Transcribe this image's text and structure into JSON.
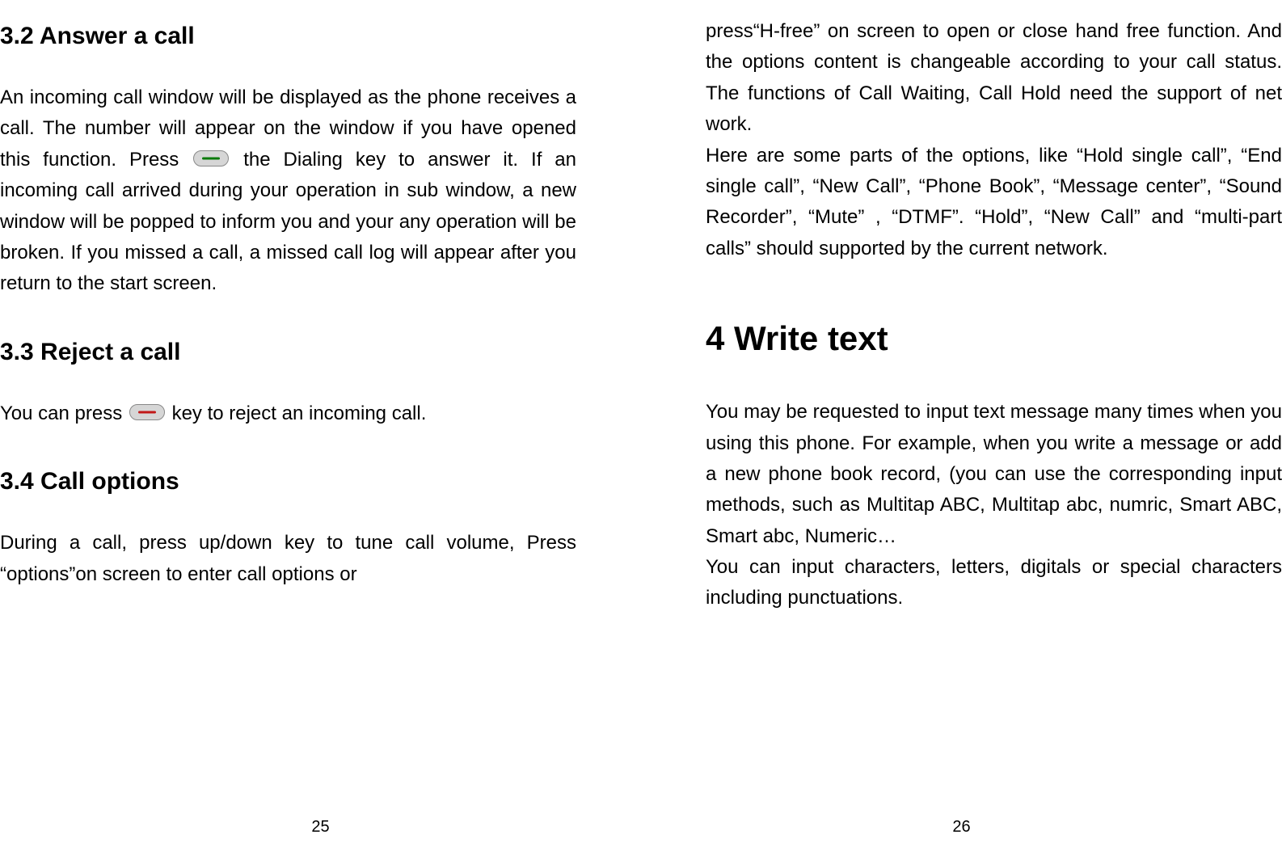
{
  "left": {
    "sec32_title": "3.2  Answer a call",
    "sec32_body_a": "An incoming call window will be displayed as the phone receives a call. The number will appear on the window if you have opened this function. Press",
    "sec32_body_b": " the Dialing key to answer it. If an incoming call arrived during your operation in sub window, a new window will be popped to inform you and your any operation will be broken. If you missed a call, a missed call log will appear after you return to the start screen.",
    "sec33_title": "3.3  Reject a call",
    "sec33_body_a": "You can press ",
    "sec33_body_b": "key to reject an incoming call.",
    "sec34_title": "3.4  Call options",
    "sec34_body": "During a call, press up/down key to tune call volume, Press “options”on screen to enter call options or",
    "page_num": "25"
  },
  "right": {
    "cont_body": "press“H-free” on screen to open or close hand free function. And the options content is changeable according to your call status. The functions of Call Waiting, Call Hold need the support of net work.",
    "cont_body2": "Here are some parts of the options, like “Hold single call”, “End single call”, “New Call”, “Phone Book”, “Message center”, “Sound Recorder”, “Mute” , “DTMF”. “Hold”, “New Call” and “multi-part calls” should supported by the current network.",
    "chap4_title": "4  Write text",
    "chap4_body1": "You may be requested to input text message many times when you using this phone. For example, when you write a message or add a new phone book record, (you can use the corresponding input methods, such as Multitap ABC, Multitap abc, numric, Smart ABC, Smart abc, Numeric…",
    "chap4_body2": "You can input characters, letters, digitals or special characters including punctuations.",
    "page_num": "26"
  }
}
